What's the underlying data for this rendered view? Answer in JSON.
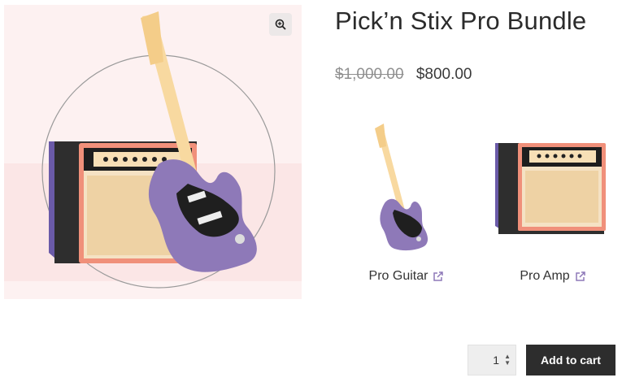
{
  "product": {
    "title": "Pick’n Stix Pro Bundle",
    "price_regular": "$1,000.00",
    "price_sale": "$800.00"
  },
  "gallery": {
    "zoom_icon": "magnifier-plus-icon"
  },
  "bundle_items": [
    {
      "name": "Pro Guitar",
      "icon": "external-link-icon"
    },
    {
      "name": "Pro Amp",
      "icon": "external-link-icon"
    }
  ],
  "cart": {
    "quantity": "1",
    "add_label": "Add to cart"
  },
  "colors": {
    "guitar_body": "#8e79b8",
    "amp_trim": "#f2967e",
    "button_bg": "#2d2d2d"
  }
}
